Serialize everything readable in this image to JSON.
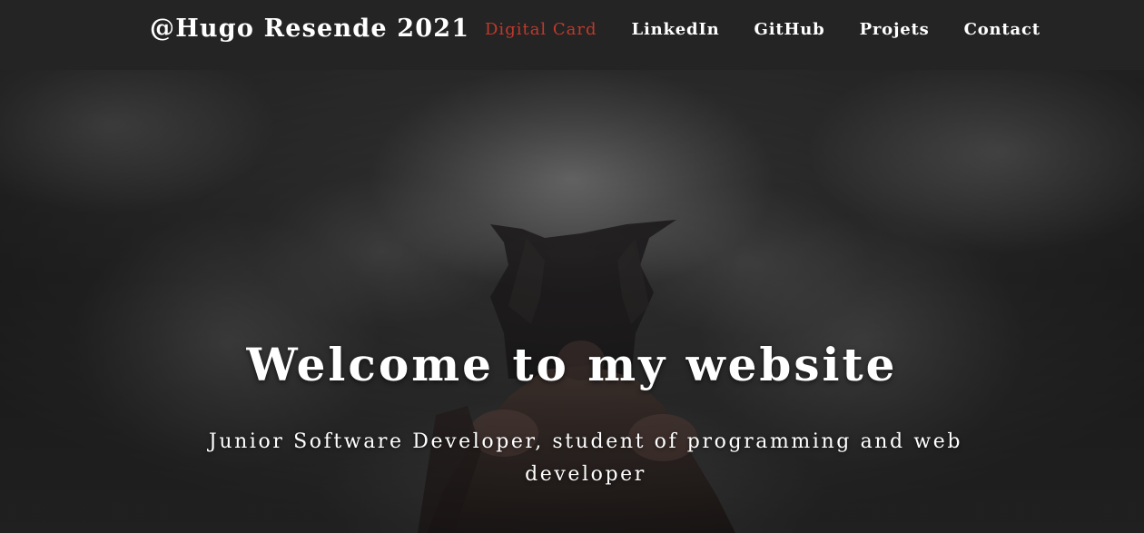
{
  "navbar": {
    "brand": "@Hugo Resende 2021",
    "links": [
      {
        "label": "Digital Card",
        "active": true
      },
      {
        "label": "LinkedIn",
        "active": false
      },
      {
        "label": "GitHub",
        "active": false
      },
      {
        "label": "Projets",
        "active": false
      },
      {
        "label": "Contact",
        "active": false
      }
    ]
  },
  "hero": {
    "title": "Welcome to my website",
    "subtitle": "Junior Software Developer, student of programming and web developer"
  },
  "colors": {
    "navbar_bg": "#242424",
    "active_link": "#c0392b",
    "text": "#ffffff"
  }
}
